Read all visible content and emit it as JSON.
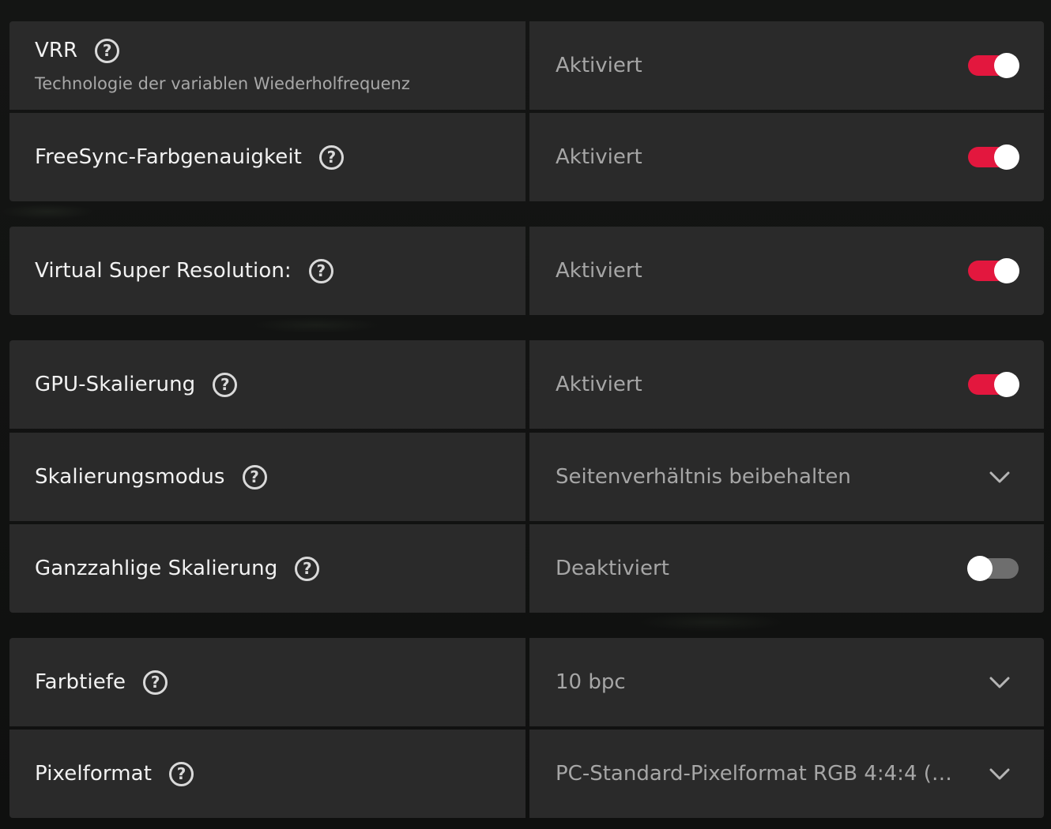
{
  "colors": {
    "accent": "#e3173e",
    "panel": "#2a2a2a",
    "background": "#111211"
  },
  "settings": [
    {
      "label": "VRR",
      "sublabel": "Technologie der variablen Wiederholfrequenz",
      "value": "Aktiviert",
      "control": "toggle",
      "enabled": true
    },
    {
      "label": "FreeSync-Farbgenauigkeit",
      "value": "Aktiviert",
      "control": "toggle",
      "enabled": true
    },
    {
      "label": "Virtual Super Resolution:",
      "value": "Aktiviert",
      "control": "toggle",
      "enabled": true
    },
    {
      "label": "GPU-Skalierung",
      "value": "Aktiviert",
      "control": "toggle",
      "enabled": true
    },
    {
      "label": "Skalierungsmodus",
      "value": "Seitenverhältnis beibehalten",
      "control": "dropdown"
    },
    {
      "label": "Ganzzahlige Skalierung",
      "value": "Deaktiviert",
      "control": "toggle",
      "enabled": false
    },
    {
      "label": "Farbtiefe",
      "value": "10 bpc",
      "control": "dropdown"
    },
    {
      "label": "Pixelformat",
      "value": "PC-Standard-Pixelformat RGB 4:4:4 (vol...",
      "control": "dropdown"
    }
  ],
  "icons": {
    "help": "question-circle-icon",
    "toggle": "toggle-switch-icon",
    "dropdown": "chevron-down-icon"
  },
  "help_glyph": "?"
}
